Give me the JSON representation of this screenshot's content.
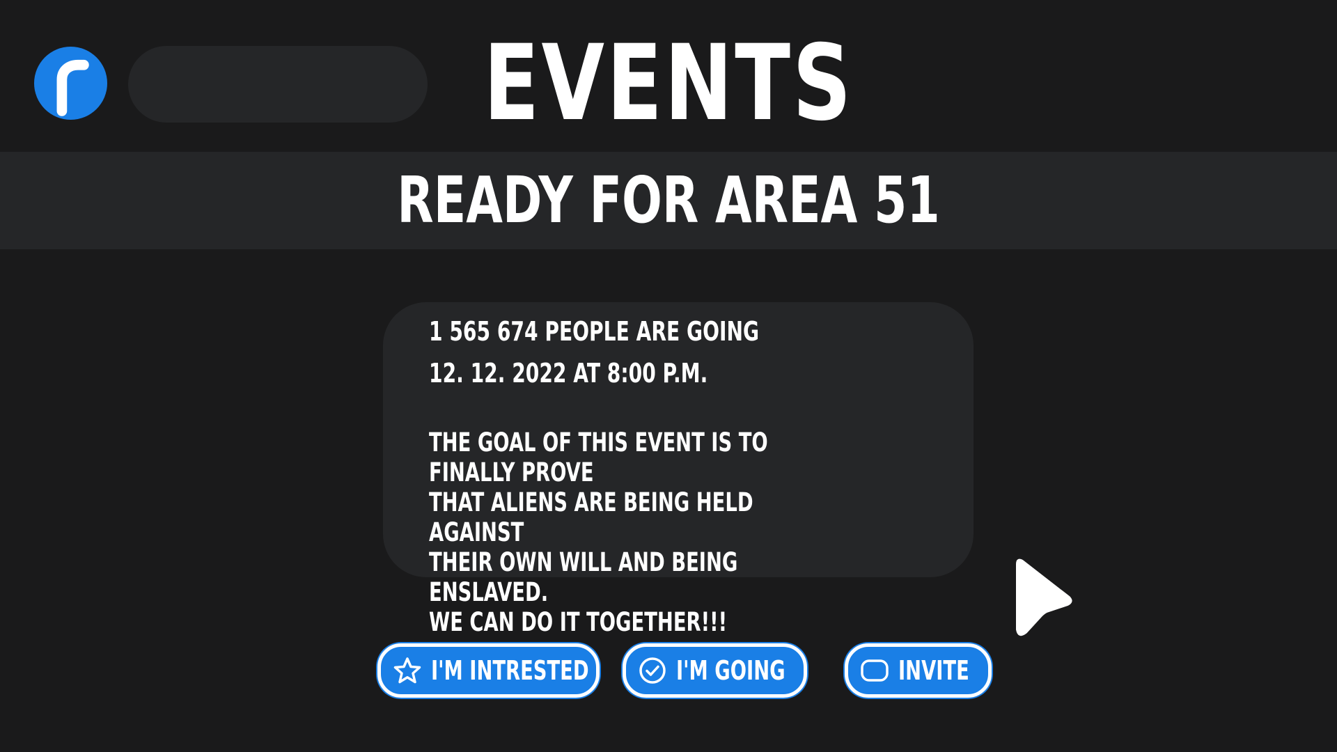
{
  "header": {
    "logo_icon": "reddit-style-r-logo-icon",
    "search_value": "",
    "search_placeholder": "",
    "title": "EVENTS"
  },
  "event": {
    "title": "READY FOR AREA 51",
    "attendees": "1 565 674 PEOPLE ARE GOING",
    "datetime": "12. 12. 2022 AT 8:00 P.M.",
    "description": "THE GOAL OF THIS EVENT IS TO FINALLY PROVE\nTHAT ALIENS ARE BEING HELD AGAINST\nTHEIR OWN WILL AND BEING ENSLAVED.\nWE CAN DO IT TOGETHER!!!"
  },
  "actions": {
    "interested": {
      "label": "I'M INTRESTED",
      "icon": "star-outline-icon"
    },
    "going": {
      "label": "I'M GOING",
      "icon": "check-circle-icon"
    },
    "invite": {
      "label": "INVITE",
      "icon": "rounded-square-icon"
    }
  },
  "pointer": {
    "icon": "mouse-cursor-icon"
  },
  "colors": {
    "background": "#1a1a1b",
    "panel": "#252628",
    "accent": "#1a7fe6",
    "text": "#ffffff"
  }
}
